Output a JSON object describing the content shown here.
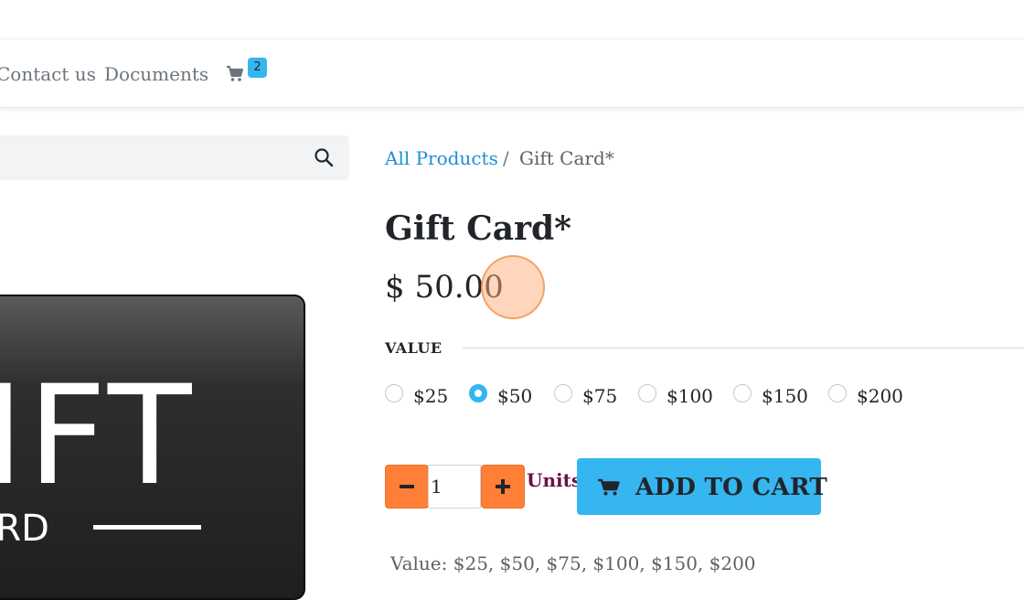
{
  "nav": {
    "items": [
      {
        "label": "Contact us"
      },
      {
        "label": "Documents"
      }
    ],
    "cart_count": "2"
  },
  "breadcrumb": {
    "parent": "All Products",
    "separator": "/",
    "current": "Gift Card*"
  },
  "product": {
    "title": "Gift Card*",
    "price": "$ 50.00",
    "image_text_big": "IFT",
    "image_text_small": "ARD"
  },
  "attribute": {
    "label": "VALUE",
    "options": [
      {
        "label": "$25",
        "selected": false
      },
      {
        "label": "$50",
        "selected": true
      },
      {
        "label": "$75",
        "selected": false
      },
      {
        "label": "$100",
        "selected": false
      },
      {
        "label": "$150",
        "selected": false
      },
      {
        "label": "$200",
        "selected": false
      }
    ]
  },
  "quantity": {
    "value": "1",
    "minus_label": "−",
    "plus_label": "+",
    "units": "Units"
  },
  "add_to_cart": {
    "label": "ADD TO CART"
  },
  "description": {
    "value_line": "Value: $25, $50, $75, $100, $150, $200"
  },
  "colors": {
    "accent": "#35b6f0",
    "stepper": "#fe7f35",
    "link": "#1f8fd4",
    "units": "#6a1144"
  }
}
